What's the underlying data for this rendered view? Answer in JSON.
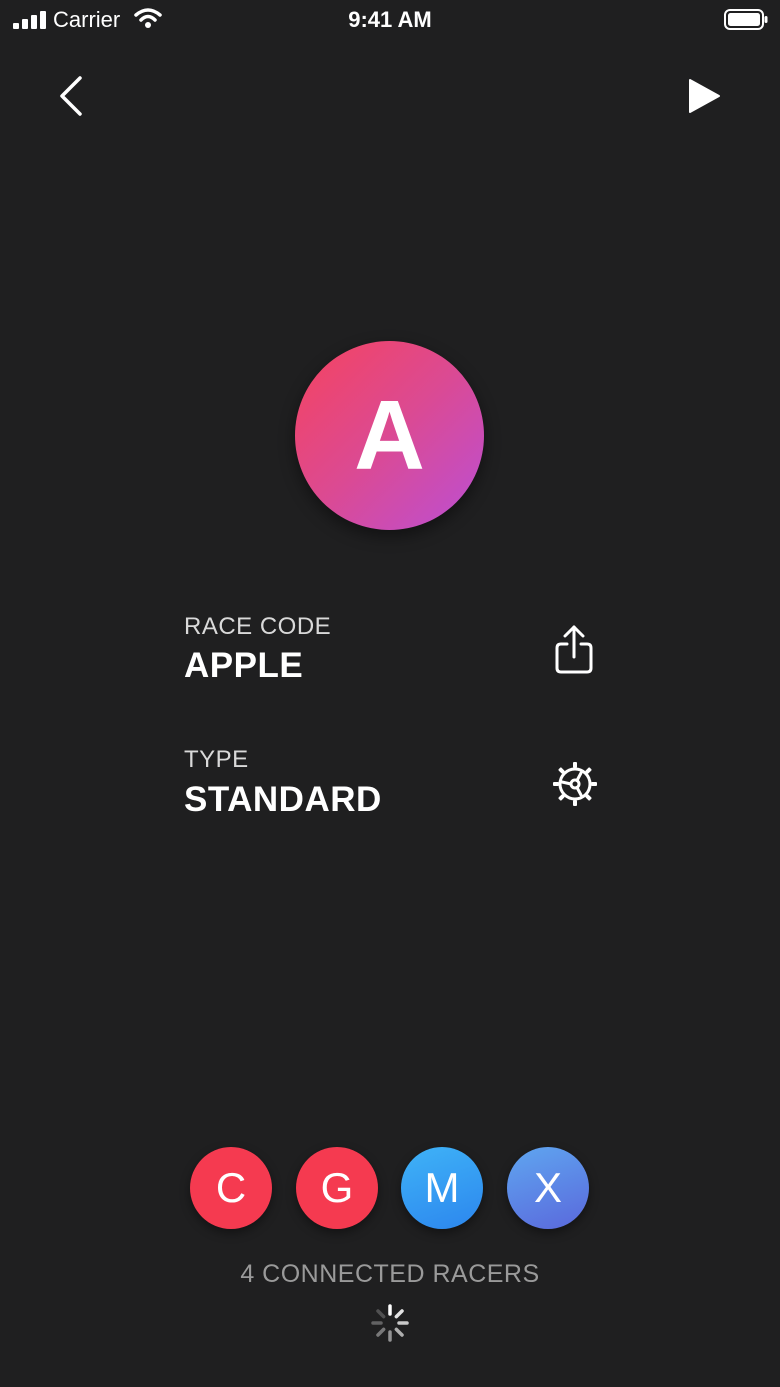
{
  "status_bar": {
    "carrier": "Carrier",
    "time": "9:41 AM",
    "signal_icon": "cellular-signal-icon",
    "wifi_icon": "wifi-icon",
    "battery_icon": "battery-icon"
  },
  "nav": {
    "back_icon": "chevron-left-icon",
    "play_icon": "play-icon"
  },
  "avatar": {
    "letter": "A",
    "gradient": [
      "#f6435e",
      "#db4a93",
      "#bb4fd6"
    ]
  },
  "race_code": {
    "label": "RACE CODE",
    "value": "APPLE",
    "icon": "share-icon"
  },
  "type": {
    "label": "TYPE",
    "value": "STANDARD",
    "icon": "settings-gear-icon"
  },
  "racers": [
    {
      "letter": "C",
      "color": "#f53a50"
    },
    {
      "letter": "G",
      "color": "#f53a50"
    },
    {
      "letter": "M",
      "color": "#2f8ef0"
    },
    {
      "letter": "X",
      "color": "#5a7ae4"
    }
  ],
  "connected_text": "4 CONNECTED RACERS",
  "spinner_icon": "loading-spinner-icon",
  "colors": {
    "background": "#1f1f20",
    "text": "#ffffff",
    "muted": "#9a9a9a"
  }
}
